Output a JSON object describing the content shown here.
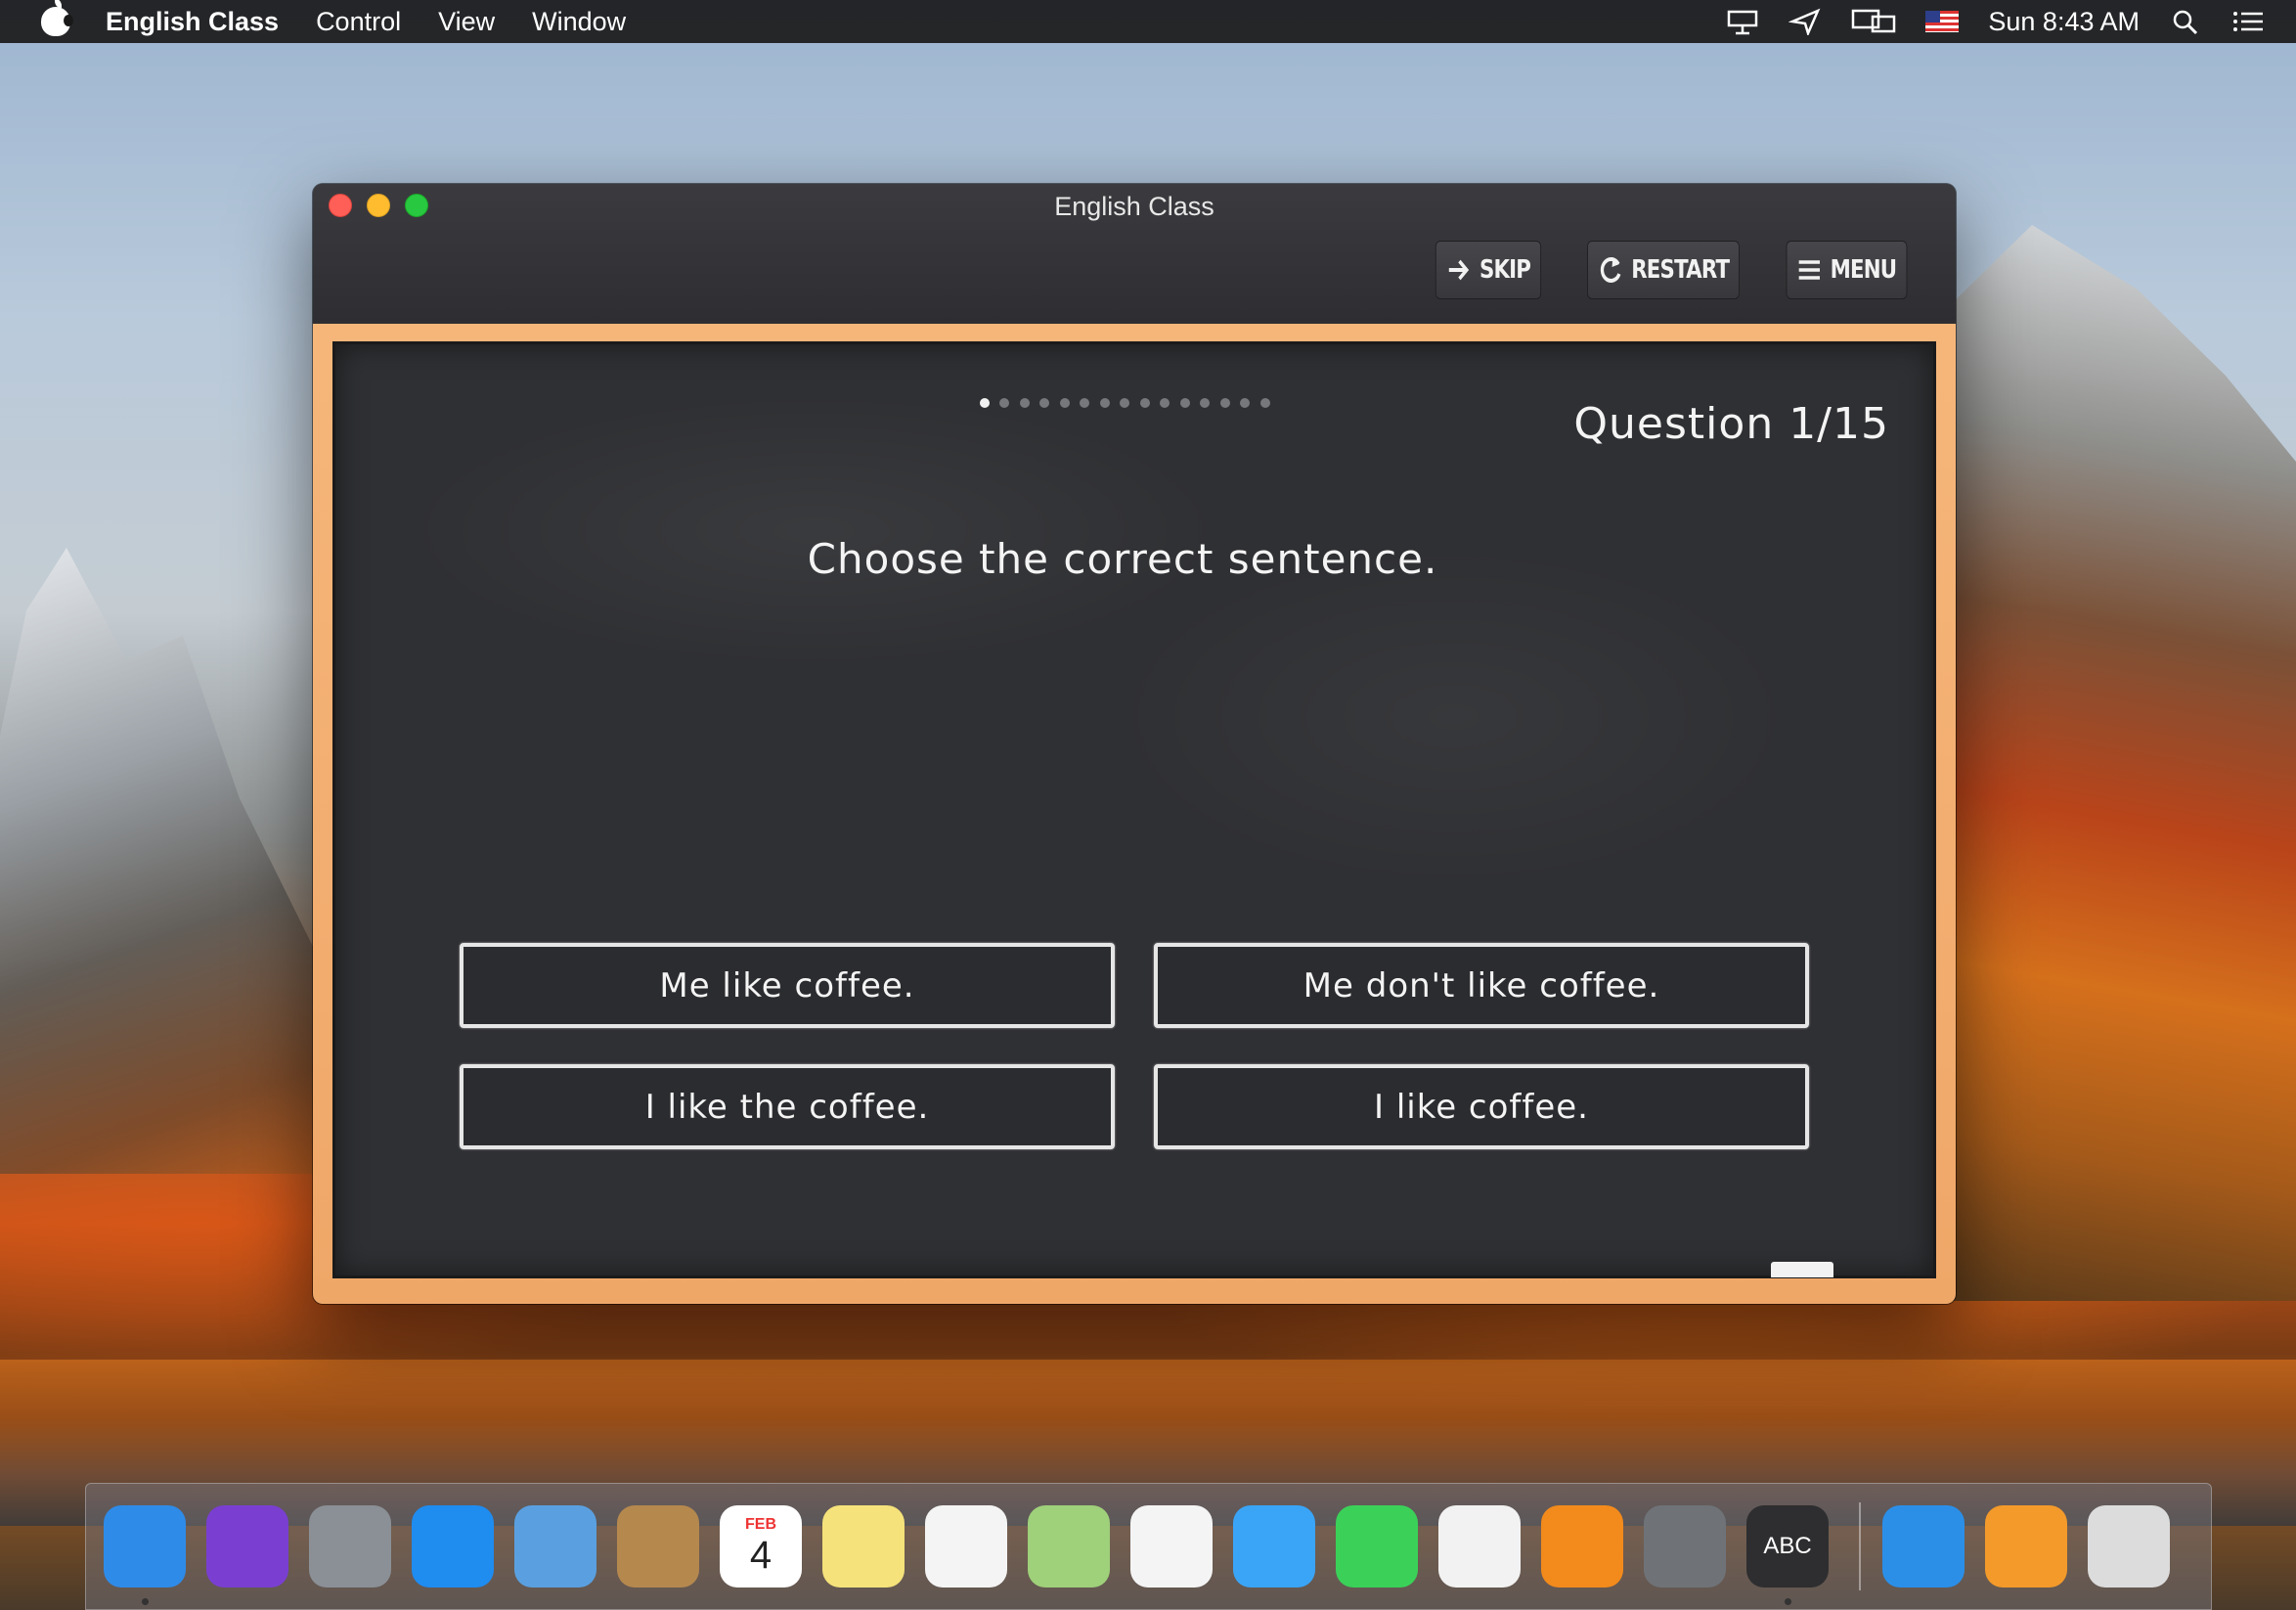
{
  "menubar": {
    "app_name": "English Class",
    "items": [
      "Control",
      "View",
      "Window"
    ],
    "clock": "Sun 8:43 AM"
  },
  "window": {
    "title": "English Class",
    "toolbar": {
      "skip_label": "SKIP",
      "restart_label": "RESTART",
      "menu_label": "MENU"
    }
  },
  "quiz": {
    "question_number": "Question 1/15",
    "current": 1,
    "total": 15,
    "prompt": "Choose the correct sentence.",
    "answers": [
      "Me like coffee.",
      "Me don't like coffee.",
      "I like the coffee.",
      "I like coffee."
    ]
  },
  "dock": {
    "apps": [
      {
        "name": "finder-icon",
        "color": "#2f8be8"
      },
      {
        "name": "siri-icon",
        "color": "#7a3fd1"
      },
      {
        "name": "launchpad-icon",
        "color": "#8b9096"
      },
      {
        "name": "safari-icon",
        "color": "#1f8cf0"
      },
      {
        "name": "mail-icon",
        "color": "#5aa0e0"
      },
      {
        "name": "contacts-icon",
        "color": "#b5884e"
      },
      {
        "name": "calendar-icon",
        "color": "#ffffff"
      },
      {
        "name": "notes-icon",
        "color": "#f5e27a"
      },
      {
        "name": "reminders-icon",
        "color": "#f4f4f4"
      },
      {
        "name": "maps-icon",
        "color": "#9fd07a"
      },
      {
        "name": "photos-icon",
        "color": "#f4f4f4"
      },
      {
        "name": "messages-icon",
        "color": "#3aa5f7"
      },
      {
        "name": "facetime-icon",
        "color": "#3bd159"
      },
      {
        "name": "itunes-icon",
        "color": "#f2f2f2"
      },
      {
        "name": "ibooks-icon",
        "color": "#f28a1c"
      },
      {
        "name": "system-preferences-icon",
        "color": "#6f7378"
      },
      {
        "name": "english-class-icon",
        "color": "#2e2e30"
      }
    ],
    "extra_apps": [
      {
        "name": "reeder-icon",
        "color": "#2b8fe8"
      },
      {
        "name": "downloads-folder-icon",
        "color": "#f39a2a"
      },
      {
        "name": "trash-icon",
        "color": "#dcdcdc"
      }
    ],
    "calendar_month": "FEB",
    "calendar_day": "4",
    "english_class_badge": "ABC"
  }
}
